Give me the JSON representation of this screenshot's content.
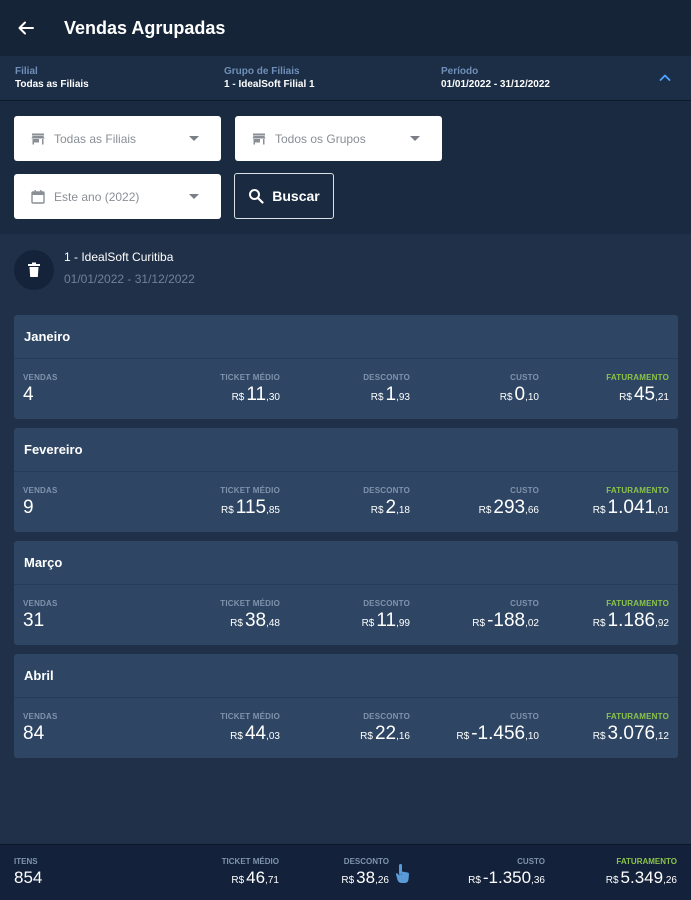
{
  "appbar": {
    "title": "Vendas Agrupadas"
  },
  "summary": {
    "filial_label": "Filial",
    "filial_value": "Todas as Filiais",
    "grupo_label": "Grupo de Filiais",
    "grupo_value": "1 - IdealSoft Filial 1",
    "periodo_label": "Período",
    "periodo_value": "01/01/2022 - 31/12/2022"
  },
  "filters": {
    "filiais": "Todas as Filiais",
    "grupos": "Todos os Grupos",
    "periodo": "Este ano (2022)",
    "search_label": "Buscar"
  },
  "branch": {
    "name": "1 - IdealSoft Curitiba",
    "period": "01/01/2022 - 31/12/2022"
  },
  "labels": {
    "vendas": "VENDAS",
    "ticket": "TICKET MÉDIO",
    "desconto": "DESCONTO",
    "custo": "CUSTO",
    "faturamento": "FATURAMENTO",
    "itens": "ITENS",
    "currency": "R$"
  },
  "months": [
    {
      "name": "Janeiro",
      "vendas": "4",
      "ticket": [
        "11",
        ",30"
      ],
      "desconto": [
        "1",
        ",93"
      ],
      "custo": [
        "0",
        ",10"
      ],
      "faturamento": [
        "45",
        ",21"
      ]
    },
    {
      "name": "Fevereiro",
      "vendas": "9",
      "ticket": [
        "115",
        ",85"
      ],
      "desconto": [
        "2",
        ",18"
      ],
      "custo": [
        "293",
        ",66"
      ],
      "faturamento": [
        "1.041",
        ",01"
      ]
    },
    {
      "name": "Março",
      "vendas": "31",
      "ticket": [
        "38",
        ",48"
      ],
      "desconto": [
        "11",
        ",99"
      ],
      "custo": [
        "-188",
        ",02"
      ],
      "faturamento": [
        "1.186",
        ",92"
      ]
    },
    {
      "name": "Abril",
      "vendas": "84",
      "ticket": [
        "44",
        ",03"
      ],
      "desconto": [
        "22",
        ",16"
      ],
      "custo": [
        "-1.456",
        ",10"
      ],
      "faturamento": [
        "3.076",
        ",12"
      ]
    }
  ],
  "totals": {
    "itens": "854",
    "ticket": [
      "46",
      ",71"
    ],
    "desconto": [
      "38",
      ",26"
    ],
    "custo": [
      "-1.350",
      ",36"
    ],
    "faturamento": [
      "5.349",
      ",26"
    ]
  },
  "colors": {
    "background": "#1a2a40",
    "card": "#2e4663",
    "accent_green": "#8bc34a",
    "label": "#7f93ad"
  },
  "icons": {
    "back": "arrow-left-icon",
    "collapse": "chevron-up-icon",
    "store": "store-icon",
    "calendar": "calendar-icon",
    "search": "search-icon",
    "trash": "trash-icon",
    "touch": "touch-hand-icon"
  }
}
